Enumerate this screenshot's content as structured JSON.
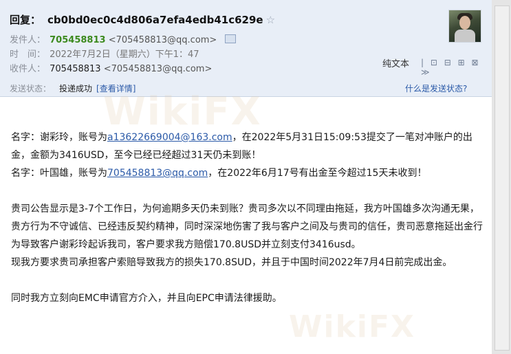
{
  "header": {
    "subject_label": "回复：",
    "subject": "cb0bd0ec0c4d806a7efa4edb41c629e",
    "from_label": "发件人：",
    "from_name": "705458813",
    "from_addr": "<705458813@qq.com>",
    "time_label": "时　间：",
    "time_value": "2022年7月2日（星期六）下午1：47",
    "to_label": "收件人：",
    "to_name": "705458813",
    "to_addr": "<705458813@qq.com>",
    "plain_text": "纯文本",
    "toolbar_icons": "| ⊡ ⊟ ⊞ ⊠ ≫"
  },
  "status": {
    "label": "发送状态：",
    "value": "投递成功",
    "detail_link": "[查看详情]",
    "why_link": "什么是发送状态?"
  },
  "body": {
    "line1_pre": "名字：谢彩玲，账号为",
    "line1_email": "a13622669004@163.com",
    "line1_post": "，在2022年5月31日15:09:53提交了一笔对冲账户的出金，金额为3416USD，至今已经已经超过31天仍未到账！",
    "line2_pre": "名字：叶国雄，账号为",
    "line2_email": "705458813@qq.com",
    "line2_post": "，在2022年6月17号有出金至今超过15天未收到！",
    "para2": "贵司公告显示是3-7个工作日，为何逾期多天仍未到账？贵司多次以不同理由拖延，我方叶国雄多次沟通无果，贵方行为不守诚信、已经违反契约精神，同时深深地伤害了我与客户之间及与贵司的信任，贵司恶意拖延出金行为导致客户谢彩玲起诉我司，客户要求我方赔偿170.8USD并立刻支付3416usd。",
    "para3": "现我方要求贵司承担客户索赔导致我方的损失170.8SUD，并且于中国时间2022年7月4日前完成出金。",
    "para4": "同时我方立刻向EMC申请官方介入，并且向EPC申请法律援助。"
  },
  "watermark": "WikiFX",
  "colors": {
    "header_bg": "#e8eef7",
    "sender_green": "#3c8a1e",
    "link_blue": "#2b5aa8"
  }
}
